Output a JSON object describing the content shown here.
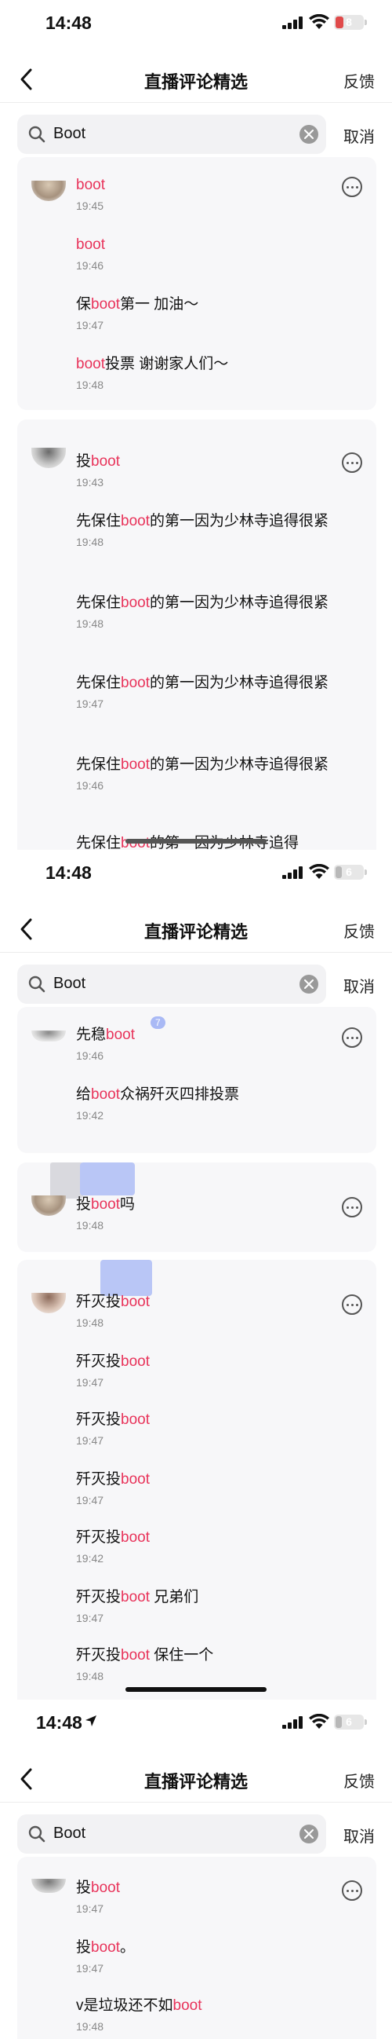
{
  "screens": [
    {
      "status": {
        "time": "14:48",
        "battery": "8"
      },
      "nav": {
        "title": "直播评论精选",
        "feedback": "反馈"
      },
      "search": {
        "query": "Boot",
        "cancel": "取消"
      },
      "cards": [
        {
          "comments": [
            {
              "pre": "",
              "hl": "boot",
              "post": "",
              "time": "19:45"
            },
            {
              "pre": "",
              "hl": "boot",
              "post": "",
              "time": "19:46"
            },
            {
              "pre": "保",
              "hl": "boot",
              "post": "第一 加油～",
              "time": "19:47"
            },
            {
              "pre": "",
              "hl": "boot",
              "post": "投票 谢谢家人们～",
              "time": "19:48"
            }
          ]
        },
        {
          "comments": [
            {
              "pre": "投",
              "hl": "boot",
              "post": "",
              "time": "19:43"
            },
            {
              "pre": "先保住",
              "hl": "boot",
              "post": "的第一因为少林寺追得很紧",
              "time": "19:48"
            },
            {
              "pre": "先保住",
              "hl": "boot",
              "post": "的第一因为少林寺追得很紧",
              "time": "19:48"
            },
            {
              "pre": "先保住",
              "hl": "boot",
              "post": "的第一因为少林寺追得很紧",
              "time": "19:47"
            },
            {
              "pre": "先保住",
              "hl": "boot",
              "post": "的第一因为少林寺追得很紧",
              "time": "19:46"
            },
            {
              "pre": "先保住",
              "hl": "boot",
              "post": "的第一因为少林寺追得",
              "time": ""
            }
          ]
        }
      ]
    },
    {
      "status": {
        "time": "14:48",
        "battery": "6"
      },
      "nav": {
        "title": "直播评论精选",
        "feedback": "反馈"
      },
      "search": {
        "query": "Boot",
        "cancel": "取消"
      },
      "cards": [
        {
          "badge": "7",
          "comments": [
            {
              "pre": "先稳",
              "hl": "boot",
              "post": "",
              "time": "19:46"
            },
            {
              "pre": "给",
              "hl": "boot",
              "post": "众祸歼灭四排投票",
              "time": "19:42"
            }
          ]
        },
        {
          "comments": [
            {
              "pre": "投",
              "hl": "boot",
              "post": "吗",
              "time": "19:48"
            }
          ]
        },
        {
          "comments": [
            {
              "pre": "歼灭投",
              "hl": "boot",
              "post": "",
              "time": "19:48"
            },
            {
              "pre": "歼灭投",
              "hl": "boot",
              "post": "",
              "time": "19:47"
            },
            {
              "pre": "歼灭投",
              "hl": "boot",
              "post": "",
              "time": "19:47"
            },
            {
              "pre": "歼灭投",
              "hl": "boot",
              "post": "",
              "time": "19:47"
            },
            {
              "pre": "歼灭投",
              "hl": "boot",
              "post": "",
              "time": "19:42"
            },
            {
              "pre": "歼灭投",
              "hl": "boot",
              "post": " 兄弟们",
              "time": "19:47"
            },
            {
              "pre": "歼灭投",
              "hl": "boot",
              "post": " 保住一个",
              "time": "19:48"
            }
          ]
        }
      ]
    },
    {
      "status": {
        "time": "14:48",
        "battery": "6"
      },
      "nav": {
        "title": "直播评论精选",
        "feedback": "反馈"
      },
      "search": {
        "query": "Boot",
        "cancel": "取消"
      },
      "cards": [
        {
          "comments": [
            {
              "pre": "投",
              "hl": "boot",
              "post": "",
              "time": "19:47"
            },
            {
              "pre": "投",
              "hl": "boot",
              "post": "。",
              "time": "19:47"
            },
            {
              "pre": "v是垃圾还不如",
              "hl": "boot",
              "post": "",
              "time": "19:48"
            }
          ]
        }
      ]
    }
  ],
  "colors": {
    "highlight": "#e8335a",
    "battery_low": "#e04a4a",
    "battery_mid": "#b8b8b8",
    "card_bg": "#f7f7f9"
  },
  "icons": [
    "back-chevron-icon",
    "search-icon",
    "clear-icon",
    "more-icon",
    "signal-icon",
    "wifi-icon",
    "battery-icon",
    "location-arrow-icon"
  ]
}
